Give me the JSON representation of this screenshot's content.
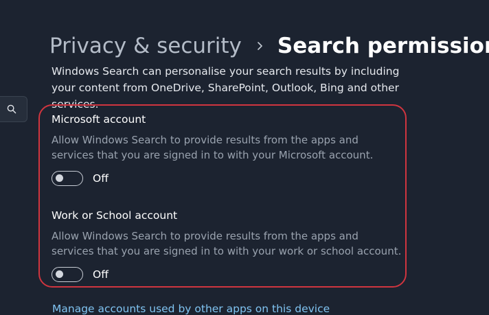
{
  "breadcrumb": {
    "parent": "Privacy & security",
    "current": "Search permissions"
  },
  "intro_text": "Windows Search can personalise your search results by including your content from OneDrive, SharePoint, Outlook, Bing and other services.",
  "sections": [
    {
      "title": "Microsoft account",
      "description": "Allow Windows Search to provide results from the apps and services that you are signed in to with your Microsoft account.",
      "toggle_state": "Off"
    },
    {
      "title": "Work or School account",
      "description": "Allow Windows Search to provide results from the apps and services that you are signed in to with your work or school account.",
      "toggle_state": "Off"
    }
  ],
  "manage_link": "Manage accounts used by other apps on this device",
  "icons": {
    "search": "search-icon",
    "separator": "chevron-right-icon"
  },
  "colors": {
    "background": "#1c2330",
    "highlight": "#d0353f",
    "link": "#80c4f2"
  }
}
